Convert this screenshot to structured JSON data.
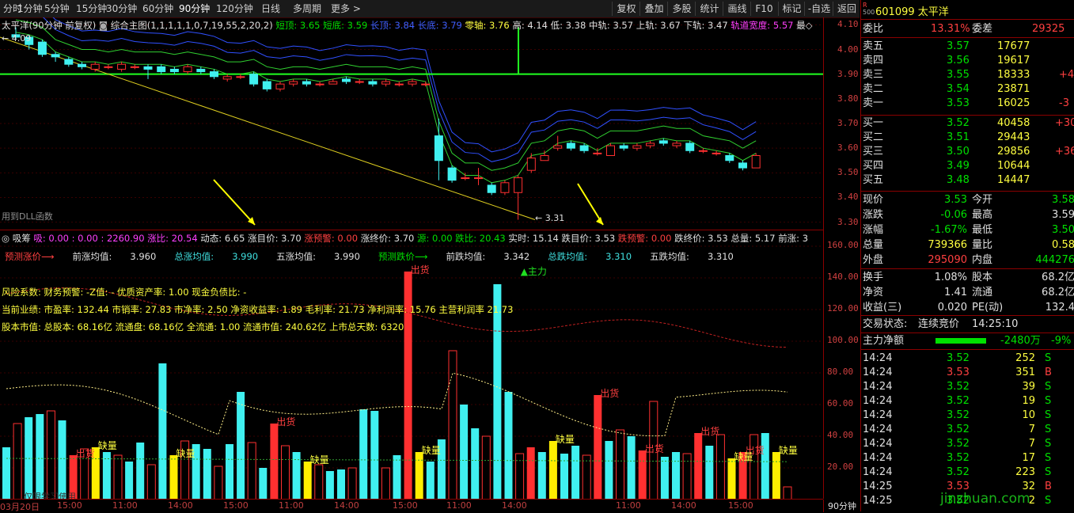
{
  "toolbar": {
    "periods": [
      "分时",
      "1分钟",
      "5分钟",
      "15分钟",
      "30分钟",
      "60分钟",
      "90分钟",
      "120分钟",
      "日线",
      "多周期",
      "更多 >"
    ],
    "active_period": "90分钟",
    "buttons": [
      "复权",
      "叠加",
      "多股",
      "统计",
      "画线",
      "F10",
      "标记",
      "-自选",
      "返回"
    ]
  },
  "main_header": {
    "title": "太平洋(90分钟 前复权)",
    "indicator": "综合主图(1,1,1,1,1,0,7,19,55,2,20,2)",
    "items": [
      {
        "label": "短顶:",
        "value": "3.65",
        "color": "#00e000"
      },
      {
        "label": "短底:",
        "value": "3.59",
        "color": "#00e000"
      },
      {
        "label": "长顶:",
        "value": "3.84",
        "color": "#4060ff"
      },
      {
        "label": "长底:",
        "value": "3.79",
        "color": "#4060ff"
      },
      {
        "label": "零轴:",
        "value": "3.76",
        "color": "#ffff40"
      },
      {
        "label": "高:",
        "value": "4.14",
        "color": "#e0e0e0"
      },
      {
        "label": "低:",
        "value": "3.38",
        "color": "#e0e0e0"
      },
      {
        "label": "中轨:",
        "value": "3.57",
        "color": "#e0e0e0"
      },
      {
        "label": "上轨:",
        "value": "3.67",
        "color": "#e0e0e0"
      },
      {
        "label": "下轨:",
        "value": "3.47",
        "color": "#e0e0e0"
      },
      {
        "label": "轨道宽度:",
        "value": "5.57",
        "color": "#ff40ff"
      }
    ],
    "tail": "最◇",
    "hi_label": "← 4.09",
    "lo_label": "← 3.31",
    "dll_label": "用到DLL函数"
  },
  "lower_header": {
    "line1": [
      {
        "text": "◎ 吸筹",
        "color": "#e0e0e0"
      },
      {
        "text": "吸: 0.00 : 0.00 : 2260.90",
        "color": "#ff40ff"
      },
      {
        "text": "涨比: 20.54",
        "color": "#ff40ff"
      },
      {
        "text": "动态: 6.65",
        "color": "#e0e0e0"
      },
      {
        "text": "涨目价: 3.70",
        "color": "#e0e0e0"
      },
      {
        "text": "涨预警: 0.00",
        "color": "#ff4040"
      },
      {
        "text": "涨终价: 3.70",
        "color": "#e0e0e0"
      },
      {
        "text": "源: 0.00",
        "color": "#00e000"
      },
      {
        "text": "跌比: 20.43",
        "color": "#00e000"
      },
      {
        "text": "实时: 15.14",
        "color": "#e0e0e0"
      },
      {
        "text": "跌目价: 3.53",
        "color": "#e0e0e0"
      },
      {
        "text": "跌预警: 0.00",
        "color": "#ff4040"
      },
      {
        "text": "跌终价: 3.53",
        "color": "#e0e0e0"
      },
      {
        "text": "总量: 5.17",
        "color": "#e0e0e0"
      },
      {
        "text": "前涨: 3",
        "color": "#e0e0e0"
      }
    ],
    "line2": [
      {
        "text": "预测涨价⟶",
        "color": "#ff4040"
      },
      {
        "text": "前涨均值:",
        "color": "#e0e0e0"
      },
      {
        "text": "3.960",
        "color": "#e0e0e0"
      },
      {
        "text": "总涨均值:",
        "color": "#40e0e0"
      },
      {
        "text": "3.990",
        "color": "#40e0e0"
      },
      {
        "text": "五涨均值:",
        "color": "#e0e0e0"
      },
      {
        "text": "3.990",
        "color": "#e0e0e0"
      },
      {
        "text": "预测跌价⟶",
        "color": "#00e000"
      },
      {
        "text": "前跌均值:",
        "color": "#e0e0e0"
      },
      {
        "text": "3.342",
        "color": "#e0e0e0"
      },
      {
        "text": "总跌均值:",
        "color": "#40e0e0"
      },
      {
        "text": "3.310",
        "color": "#40e0e0"
      },
      {
        "text": "五跌均值:",
        "color": "#e0e0e0"
      },
      {
        "text": "3.310",
        "color": "#e0e0e0"
      }
    ],
    "risk": "风险系数: 财务预警: -Z值: - 优质资产率: 1.00 现金负债比: -",
    "perf": "当前业绩: 市盈率: 132.44 市销率: 27.83 市净率: 2.50 净资收益率: 1.89 毛利率: 21.73 净利润率: 15.76 主营利润率 21.73",
    "cap": "股本市值: 总股本: 68.16亿 流通盘: 68.16亿 全流通: 1.00 流通市值: 240.62亿 上市总天数: 6320",
    "mark_out": "出货",
    "mark_lack": "缺量",
    "mark_main": "▲主力",
    "watermark": "仅限学习使用"
  },
  "price_axis": [
    "4.10",
    "4.00",
    "3.90",
    "3.80",
    "3.70",
    "3.60",
    "3.50",
    "3.40",
    "3.30"
  ],
  "vol_axis": [
    "160.00",
    "140.00",
    "120.00",
    "100.00",
    "80.00",
    "60.00",
    "40.00",
    "20.00"
  ],
  "time_axis": [
    "03月20日",
    "15:00",
    "11:00",
    "14:00",
    "15:00",
    "11:00",
    "14:00",
    "15:00",
    "11:00",
    "14:00",
    "11:00",
    "14:00",
    "15:00"
  ],
  "period_tag": "90分钟",
  "chart_data": {
    "type": "candlestick",
    "candles": [
      {
        "o": 4.06,
        "c": 4.05,
        "h": 4.09,
        "l": 4.04
      },
      {
        "o": 4.05,
        "c": 4.02,
        "h": 4.06,
        "l": 4.0
      },
      {
        "o": 4.03,
        "c": 3.98,
        "h": 4.04,
        "l": 3.97
      },
      {
        "o": 3.98,
        "c": 3.97,
        "h": 3.99,
        "l": 3.95
      },
      {
        "o": 3.96,
        "c": 3.94,
        "h": 3.97,
        "l": 3.93
      },
      {
        "o": 3.94,
        "c": 3.93,
        "h": 3.95,
        "l": 3.92
      },
      {
        "o": 3.92,
        "c": 3.94,
        "h": 3.95,
        "l": 3.91
      },
      {
        "o": 3.93,
        "c": 3.93,
        "h": 3.94,
        "l": 3.92
      },
      {
        "o": 3.92,
        "c": 3.94,
        "h": 3.95,
        "l": 3.91
      },
      {
        "o": 3.93,
        "c": 3.93,
        "h": 3.94,
        "l": 3.92
      },
      {
        "o": 3.93,
        "c": 3.92,
        "h": 3.94,
        "l": 3.88
      },
      {
        "o": 3.93,
        "c": 3.91,
        "h": 3.94,
        "l": 3.9
      },
      {
        "o": 3.92,
        "c": 3.91,
        "h": 3.93,
        "l": 3.9
      },
      {
        "o": 3.91,
        "c": 3.93,
        "h": 3.94,
        "l": 3.9
      },
      {
        "o": 3.92,
        "c": 3.91,
        "h": 3.93,
        "l": 3.9
      },
      {
        "o": 3.91,
        "c": 3.89,
        "h": 3.92,
        "l": 3.88
      },
      {
        "o": 3.88,
        "c": 3.89,
        "h": 3.9,
        "l": 3.87
      },
      {
        "o": 3.89,
        "c": 3.89,
        "h": 3.9,
        "l": 3.88
      },
      {
        "o": 3.9,
        "c": 3.86,
        "h": 3.91,
        "l": 3.85
      },
      {
        "o": 3.87,
        "c": 3.84,
        "h": 3.88,
        "l": 3.83
      },
      {
        "o": 3.84,
        "c": 3.86,
        "h": 3.87,
        "l": 3.83
      },
      {
        "o": 3.86,
        "c": 3.87,
        "h": 3.88,
        "l": 3.85
      },
      {
        "o": 3.87,
        "c": 3.86,
        "h": 3.88,
        "l": 3.85
      },
      {
        "o": 3.86,
        "c": 3.86,
        "h": 3.87,
        "l": 3.85
      },
      {
        "o": 3.86,
        "c": 3.87,
        "h": 3.88,
        "l": 3.86
      },
      {
        "o": 3.88,
        "c": 3.87,
        "h": 3.89,
        "l": 3.86
      },
      {
        "o": 3.87,
        "c": 3.87,
        "h": 3.88,
        "l": 3.86
      },
      {
        "o": 3.87,
        "c": 3.86,
        "h": 3.88,
        "l": 3.85
      },
      {
        "o": 3.86,
        "c": 3.87,
        "h": 3.88,
        "l": 3.85
      },
      {
        "o": 3.86,
        "c": 3.86,
        "h": 3.87,
        "l": 3.85
      },
      {
        "o": 3.86,
        "c": 3.87,
        "h": 3.88,
        "l": 3.85
      },
      {
        "o": 3.86,
        "c": 3.86,
        "h": 3.87,
        "l": 3.85
      },
      {
        "o": 3.65,
        "c": 3.55,
        "h": 3.72,
        "l": 3.47
      },
      {
        "o": 3.52,
        "c": 3.47,
        "h": 3.53,
        "l": 3.46
      },
      {
        "o": 3.48,
        "c": 3.48,
        "h": 3.5,
        "l": 3.47
      },
      {
        "o": 3.48,
        "c": 3.48,
        "h": 3.52,
        "l": 3.45
      },
      {
        "o": 3.45,
        "c": 3.42,
        "h": 3.46,
        "l": 3.41
      },
      {
        "o": 3.42,
        "c": 3.46,
        "h": 3.47,
        "l": 3.41
      },
      {
        "o": 3.42,
        "c": 3.48,
        "h": 3.49,
        "l": 3.31
      },
      {
        "o": 3.51,
        "c": 3.56,
        "h": 3.58,
        "l": 3.5
      },
      {
        "o": 3.55,
        "c": 3.57,
        "h": 3.59,
        "l": 3.55
      },
      {
        "o": 3.6,
        "c": 3.61,
        "h": 3.65,
        "l": 3.59
      },
      {
        "o": 3.62,
        "c": 3.6,
        "h": 3.63,
        "l": 3.59
      },
      {
        "o": 3.61,
        "c": 3.59,
        "h": 3.62,
        "l": 3.58
      },
      {
        "o": 3.58,
        "c": 3.58,
        "h": 3.6,
        "l": 3.57
      },
      {
        "o": 3.57,
        "c": 3.61,
        "h": 3.62,
        "l": 3.57
      },
      {
        "o": 3.61,
        "c": 3.6,
        "h": 3.62,
        "l": 3.59
      },
      {
        "o": 3.6,
        "c": 3.61,
        "h": 3.62,
        "l": 3.59
      },
      {
        "o": 3.61,
        "c": 3.62,
        "h": 3.63,
        "l": 3.6
      },
      {
        "o": 3.63,
        "c": 3.62,
        "h": 3.64,
        "l": 3.61
      },
      {
        "o": 3.61,
        "c": 3.62,
        "h": 3.63,
        "l": 3.6
      },
      {
        "o": 3.62,
        "c": 3.59,
        "h": 3.63,
        "l": 3.58
      },
      {
        "o": 3.59,
        "c": 3.59,
        "h": 3.6,
        "l": 3.58
      },
      {
        "o": 3.58,
        "c": 3.58,
        "h": 3.59,
        "l": 3.57
      },
      {
        "o": 3.57,
        "c": 3.55,
        "h": 3.58,
        "l": 3.54
      },
      {
        "o": 3.54,
        "c": 3.52,
        "h": 3.55,
        "l": 3.51
      },
      {
        "o": 3.52,
        "c": 3.57,
        "h": 3.58,
        "l": 3.52
      }
    ],
    "volume": [
      33,
      48,
      52,
      54,
      56,
      50,
      28,
      32,
      33,
      30,
      28,
      24,
      36,
      22,
      86,
      28,
      37,
      35,
      32,
      21,
      35,
      68,
      36,
      20,
      48,
      34,
      30,
      24,
      22,
      18,
      19,
      20,
      57,
      56,
      20,
      28,
      144,
      30,
      24,
      38,
      94,
      60,
      45,
      40,
      136,
      68,
      29,
      33,
      30,
      37,
      29,
      34,
      28,
      66,
      37,
      44,
      40,
      31,
      62,
      27,
      30,
      29,
      42,
      34,
      41,
      26,
      30,
      41,
      42,
      30,
      8
    ],
    "vol_ylim": [
      0,
      170
    ],
    "price_ylim": [
      3.27,
      4.13
    ]
  },
  "quote": {
    "code": "601099",
    "name": "太平洋",
    "weibi": {
      "label": "委比",
      "value": "13.31%"
    },
    "weicha": {
      "label": "委差",
      "value": "29325"
    },
    "asks": [
      {
        "label": "卖五",
        "price": "3.57",
        "vol": "17677",
        "chg": ""
      },
      {
        "label": "卖四",
        "price": "3.56",
        "vol": "19617",
        "chg": ""
      },
      {
        "label": "卖三",
        "price": "3.55",
        "vol": "18333",
        "chg": "+4"
      },
      {
        "label": "卖二",
        "price": "3.54",
        "vol": "23871",
        "chg": ""
      },
      {
        "label": "卖一",
        "price": "3.53",
        "vol": "16025",
        "chg": "-3"
      }
    ],
    "bids": [
      {
        "label": "买一",
        "price": "3.52",
        "vol": "40458",
        "chg": "+30"
      },
      {
        "label": "买二",
        "price": "3.51",
        "vol": "29443",
        "chg": ""
      },
      {
        "label": "买三",
        "price": "3.50",
        "vol": "29856",
        "chg": "+36"
      },
      {
        "label": "买四",
        "price": "3.49",
        "vol": "10644",
        "chg": ""
      },
      {
        "label": "买五",
        "price": "3.48",
        "vol": "14447",
        "chg": ""
      }
    ],
    "stats": [
      {
        "l1": "现价",
        "v1": "3.53",
        "c1": "#00e000",
        "l2": "今开",
        "v2": "3.58",
        "c2": "#00e000"
      },
      {
        "l1": "涨跌",
        "v1": "-0.06",
        "c1": "#00e000",
        "l2": "最高",
        "v2": "3.59",
        "c2": "#e0e0e0"
      },
      {
        "l1": "涨幅",
        "v1": "-1.67%",
        "c1": "#00e000",
        "l2": "最低",
        "v2": "3.50",
        "c2": "#00e000"
      },
      {
        "l1": "总量",
        "v1": "739366",
        "c1": "#ffff40",
        "l2": "量比",
        "v2": "0.58",
        "c2": "#ffff40"
      },
      {
        "l1": "外盘",
        "v1": "295090",
        "c1": "#ff4040",
        "l2": "内盘",
        "v2": "444276",
        "c2": "#00e000"
      }
    ],
    "stats2": [
      {
        "l1": "换手",
        "v1": "1.08%",
        "l2": "股本",
        "v2": "68.2亿"
      },
      {
        "l1": "净资",
        "v1": "1.41",
        "l2": "流通",
        "v2": "68.2亿"
      },
      {
        "l1": "收益(三)",
        "v1": "0.020",
        "l2": "PE(动)",
        "v2": "132.4"
      }
    ],
    "status": {
      "label": "交易状态:",
      "value": "连续竞价",
      "time": "14:25:10"
    },
    "mainflow": {
      "label": "主力净额",
      "value": "-2480万",
      "pct": "-9%"
    },
    "ticks": [
      {
        "t": "14:24",
        "p": "3.52",
        "v": "252",
        "s": "S"
      },
      {
        "t": "14:24",
        "p": "3.53",
        "v": "351",
        "s": "B"
      },
      {
        "t": "14:24",
        "p": "3.52",
        "v": "39",
        "s": "S"
      },
      {
        "t": "14:24",
        "p": "3.52",
        "v": "19",
        "s": "S"
      },
      {
        "t": "14:24",
        "p": "3.52",
        "v": "10",
        "s": "S"
      },
      {
        "t": "14:24",
        "p": "3.52",
        "v": "7",
        "s": "S"
      },
      {
        "t": "14:24",
        "p": "3.52",
        "v": "7",
        "s": "S"
      },
      {
        "t": "14:24",
        "p": "3.52",
        "v": "17",
        "s": "S"
      },
      {
        "t": "14:24",
        "p": "3.52",
        "v": "223",
        "s": "S"
      },
      {
        "t": "14:25",
        "p": "3.53",
        "v": "32",
        "s": "B"
      },
      {
        "t": "14:25",
        "p": "3.52",
        "v": "2",
        "s": "S"
      }
    ],
    "watermark": "jinzhuan.com"
  }
}
